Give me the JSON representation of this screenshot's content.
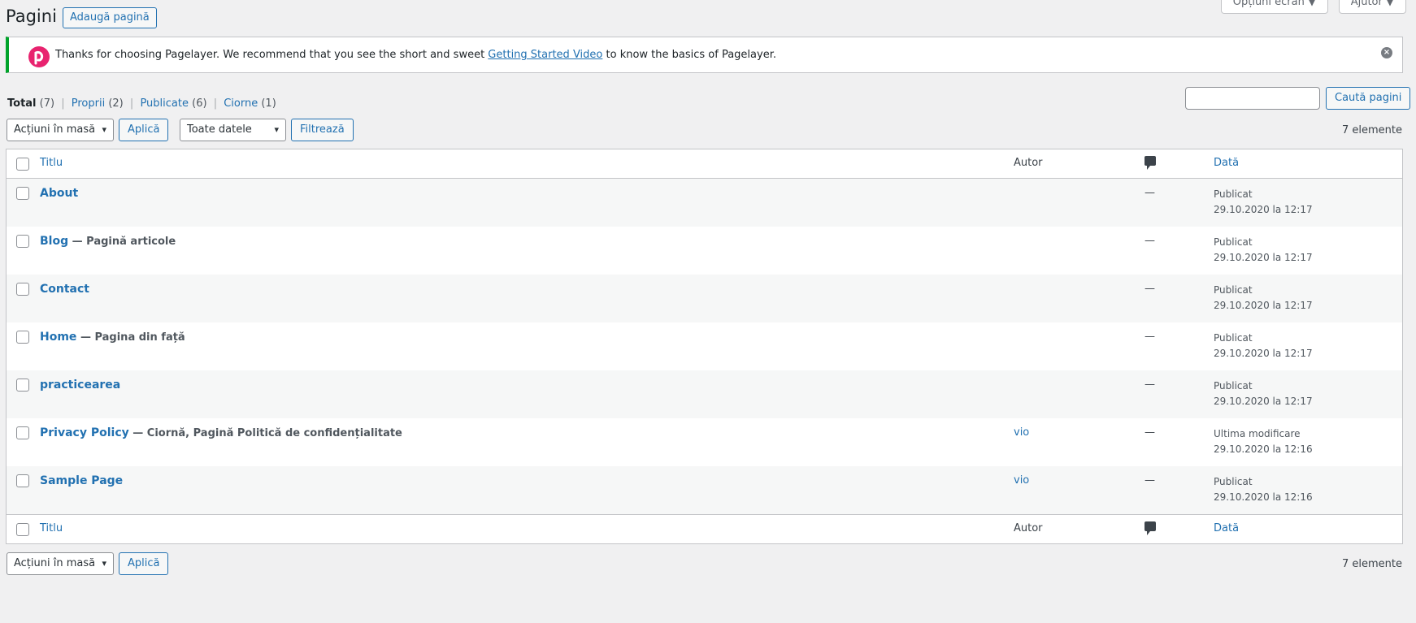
{
  "header": {
    "title": "Pagini",
    "add_new": "Adaugă pagină",
    "screen_options": "Opțiuni ecran ▼",
    "help": "Ajutor ▼"
  },
  "notice": {
    "text_before": "Thanks for choosing Pagelayer. We recommend that you see the short and sweet ",
    "link": "Getting Started Video",
    "text_after": " to know the basics of Pagelayer.",
    "dismiss": "×"
  },
  "filters": {
    "all": "Total",
    "all_count": "(7)",
    "mine": "Proprii",
    "mine_count": "(2)",
    "published": "Publicate",
    "published_count": "(6)",
    "drafts": "Ciorne",
    "drafts_count": "(1)",
    "sep": "|"
  },
  "search": {
    "button": "Caută pagini"
  },
  "actions": {
    "bulk_select": "Acțiuni în masă",
    "apply": "Aplică",
    "dates_select": "Toate datele",
    "filter": "Filtrează",
    "items_count": "7 elemente"
  },
  "table": {
    "columns": {
      "title": "Titlu",
      "author": "Autor",
      "date": "Dată"
    },
    "rows": [
      {
        "title": "About",
        "state": "",
        "author": "",
        "comments": "—",
        "status": "Publicat",
        "date": "29.10.2020 la 12:17"
      },
      {
        "title": "Blog",
        "state": " — Pagină articole",
        "author": "",
        "comments": "—",
        "status": "Publicat",
        "date": "29.10.2020 la 12:17"
      },
      {
        "title": "Contact",
        "state": "",
        "author": "",
        "comments": "—",
        "status": "Publicat",
        "date": "29.10.2020 la 12:17"
      },
      {
        "title": "Home",
        "state": " — Pagina din față",
        "author": "",
        "comments": "—",
        "status": "Publicat",
        "date": "29.10.2020 la 12:17"
      },
      {
        "title": "practicearea",
        "state": "",
        "author": "",
        "comments": "—",
        "status": "Publicat",
        "date": "29.10.2020 la 12:17"
      },
      {
        "title": "Privacy Policy",
        "state": " — Ciornă, Pagină Politică de confidențialitate",
        "author": "vio",
        "comments": "—",
        "status": "Ultima modificare",
        "date": "29.10.2020 la 12:16"
      },
      {
        "title": "Sample Page",
        "state": "",
        "author": "vio",
        "comments": "—",
        "status": "Publicat",
        "date": "29.10.2020 la 12:16"
      }
    ]
  },
  "icons": {
    "chevron": "▾",
    "comment": "comment-bubble-icon",
    "pagelayer_logo": "pagelayer-logo-icon"
  },
  "colors": {
    "accent": "#2271b1",
    "notice_border": "#00a32a",
    "logo": "#e8236f"
  }
}
